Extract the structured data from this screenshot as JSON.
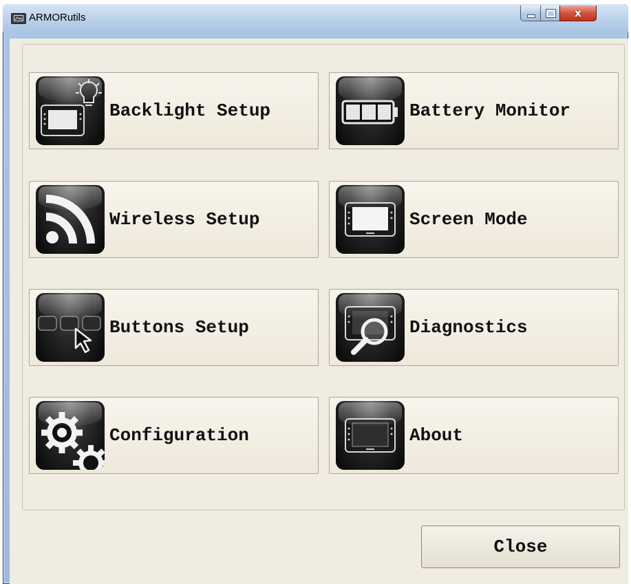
{
  "window": {
    "title": "ARMORutils",
    "controls": {
      "close_glyph": "x"
    }
  },
  "tiles": [
    {
      "label": "Backlight Setup",
      "icon": "backlight-icon"
    },
    {
      "label": "Battery Monitor",
      "icon": "battery-icon"
    },
    {
      "label": "Wireless Setup",
      "icon": "wireless-icon"
    },
    {
      "label": "Screen Mode",
      "icon": "screen-mode-icon"
    },
    {
      "label": "Buttons Setup",
      "icon": "buttons-icon"
    },
    {
      "label": "Diagnostics",
      "icon": "diagnostics-icon"
    },
    {
      "label": "Configuration",
      "icon": "gears-icon"
    },
    {
      "label": "About",
      "icon": "tablet-icon"
    }
  ],
  "footer": {
    "close_label": "Close"
  },
  "colors": {
    "dialog_bg": "#f0ece1",
    "title_bar": "#c2d6ee",
    "close_red": "#c2331c"
  }
}
